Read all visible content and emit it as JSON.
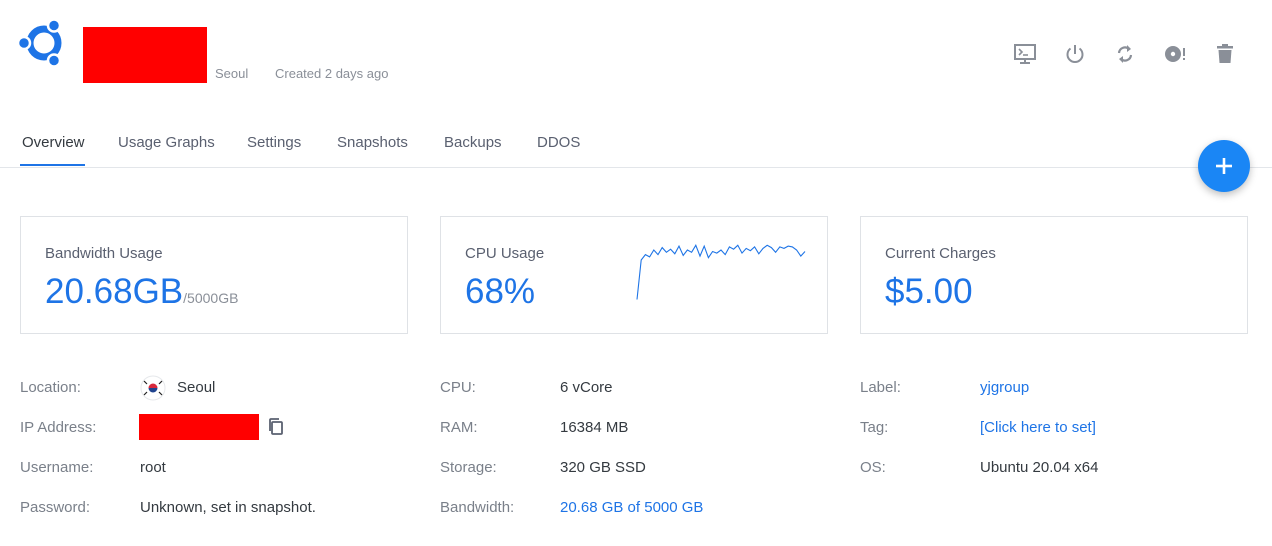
{
  "header": {
    "location": "Seoul",
    "created": "Created 2 days ago",
    "actions": [
      "console-icon",
      "power-icon",
      "restart-icon",
      "reinstall-icon",
      "delete-icon"
    ]
  },
  "tabs": [
    "Overview",
    "Usage Graphs",
    "Settings",
    "Snapshots",
    "Backups",
    "DDOS"
  ],
  "cards": {
    "bandwidth": {
      "title": "Bandwidth Usage",
      "value": "20.68GB",
      "limit": "/5000GB"
    },
    "cpu": {
      "title": "CPU Usage",
      "value": "68%",
      "sparkline": [
        2,
        53,
        60,
        57,
        66,
        60,
        69,
        63,
        67,
        61,
        71,
        59,
        66,
        63,
        72,
        58,
        71,
        56,
        64,
        62,
        66,
        60,
        70,
        67,
        72,
        62,
        68,
        65,
        70,
        61,
        68,
        72,
        69,
        63,
        70,
        68,
        71,
        70,
        66,
        58,
        64
      ]
    },
    "charges": {
      "title": "Current Charges",
      "value": "$5.00"
    }
  },
  "details": {
    "col1": [
      {
        "label": "Location:",
        "value": "Seoul"
      },
      {
        "label": "IP Address:",
        "value": ""
      },
      {
        "label": "Username:",
        "value": "root"
      },
      {
        "label": "Password:",
        "value": "Unknown, set in snapshot."
      }
    ],
    "col2": [
      {
        "label": "CPU:",
        "value": "6 vCore"
      },
      {
        "label": "RAM:",
        "value": "16384 MB"
      },
      {
        "label": "Storage:",
        "value": "320 GB SSD"
      },
      {
        "label": "Bandwidth:",
        "value": "20.68 GB of 5000 GB"
      }
    ],
    "col3": [
      {
        "label": "Label:",
        "value": "yjgroup"
      },
      {
        "label": "Tag:",
        "value": "[Click here to set]"
      },
      {
        "label": "OS:",
        "value": "Ubuntu 20.04 x64"
      }
    ]
  },
  "colors": {
    "accent": "#1e74e6",
    "fab": "#1a86f5",
    "redacted": "#ff0000"
  }
}
